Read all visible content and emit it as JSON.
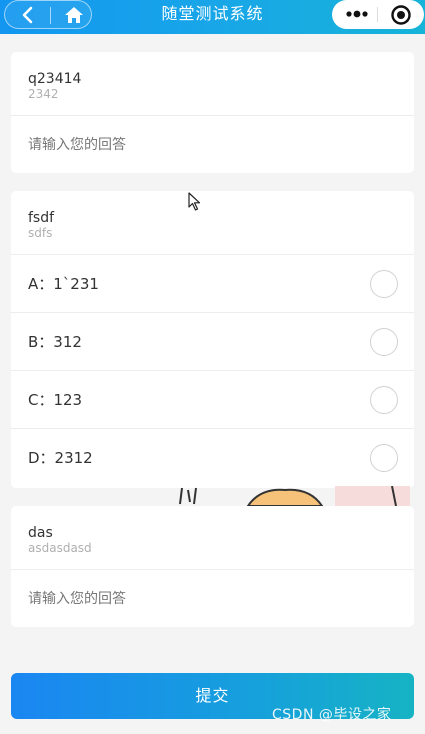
{
  "header": {
    "title": "随堂测试系统",
    "back_icon": "chevron-left-icon",
    "home_icon": "home-icon",
    "more_icon": "more-dots-icon",
    "close_icon": "target-circle-icon"
  },
  "questions": [
    {
      "title": "q23414",
      "subtitle": "2342",
      "type": "text",
      "answer_placeholder": "请输入您的回答"
    },
    {
      "title": "fsdf",
      "subtitle": "sdfs",
      "type": "choice",
      "options": [
        {
          "label": "A：1`231"
        },
        {
          "label": "B：312"
        },
        {
          "label": "C：123"
        },
        {
          "label": "D：2312"
        }
      ]
    },
    {
      "title": "das",
      "subtitle": "asdasdasd",
      "type": "text",
      "answer_placeholder": "请输入您的回答"
    }
  ],
  "submit_label": "提交",
  "watermark": "CSDN @毕设之家",
  "colors": {
    "header_start": "#1296f0",
    "header_end": "#17b3d8",
    "button_start": "#1a86f2",
    "button_end": "#16b3c4"
  }
}
